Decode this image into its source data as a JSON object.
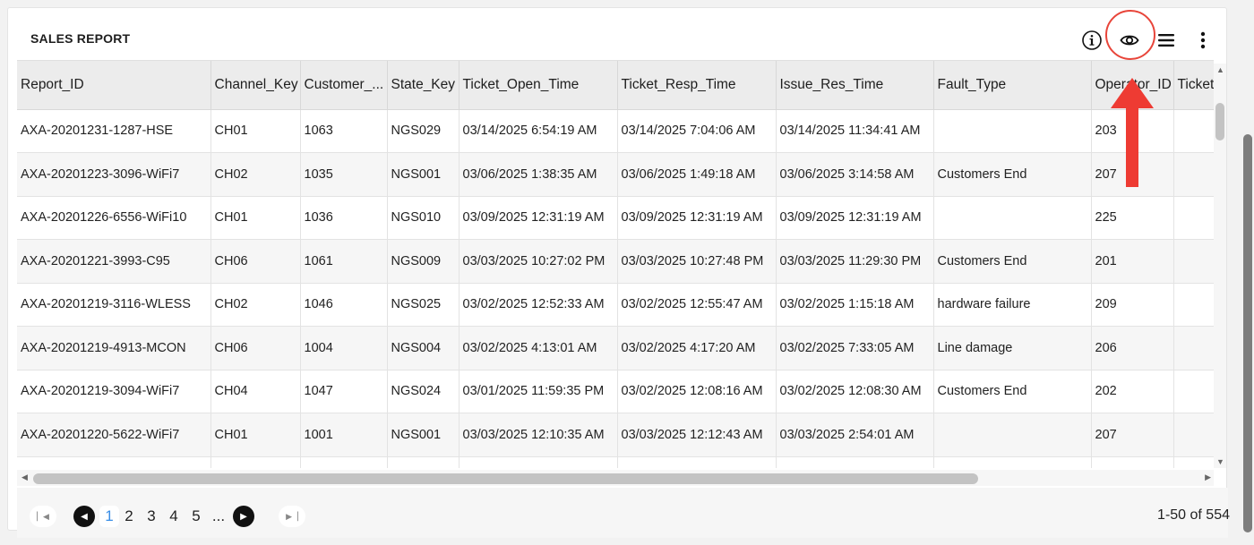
{
  "report": {
    "title": "SALES REPORT"
  },
  "toolbar": {
    "info_icon": "info-icon",
    "visibility_icon": "eye-icon",
    "columns_icon": "hamburger-menu-icon",
    "more_icon": "vertical-dots-icon",
    "highlight_color": "#e8453a"
  },
  "table": {
    "columns": [
      "Report_ID",
      "Channel_Key",
      "Customer_...",
      "State_Key",
      "Ticket_Open_Time",
      "Ticket_Resp_Time",
      "Issue_Res_Time",
      "Fault_Type",
      "Operator_ID",
      "Ticket"
    ],
    "rows": [
      [
        "AXA-20201231-1287-HSE",
        "CH01",
        "1063",
        "NGS029",
        "03/14/2025 6:54:19 AM",
        "03/14/2025 7:04:06 AM",
        "03/14/2025 11:34:41 AM",
        "",
        "203",
        ""
      ],
      [
        "AXA-20201223-3096-WiFi7",
        "CH02",
        "1035",
        "NGS001",
        "03/06/2025 1:38:35 AM",
        "03/06/2025 1:49:18 AM",
        "03/06/2025 3:14:58 AM",
        "Customers End",
        "207",
        ""
      ],
      [
        "AXA-20201226-6556-WiFi10",
        "CH01",
        "1036",
        "NGS010",
        "03/09/2025 12:31:19 AM",
        "03/09/2025 12:31:19 AM",
        "03/09/2025 12:31:19 AM",
        "",
        "225",
        ""
      ],
      [
        "AXA-20201221-3993-C95",
        "CH06",
        "1061",
        "NGS009",
        "03/03/2025 10:27:02 PM",
        "03/03/2025 10:27:48 PM",
        "03/03/2025 11:29:30 PM",
        "Customers End",
        "201",
        ""
      ],
      [
        "AXA-20201219-3116-WLESS",
        "CH02",
        "1046",
        "NGS025",
        "03/02/2025 12:52:33 AM",
        "03/02/2025 12:55:47 AM",
        "03/02/2025 1:15:18 AM",
        "hardware failure",
        "209",
        ""
      ],
      [
        "AXA-20201219-4913-MCON",
        "CH06",
        "1004",
        "NGS004",
        "03/02/2025 4:13:01 AM",
        "03/02/2025 4:17:20 AM",
        "03/02/2025 7:33:05 AM",
        "Line damage",
        "206",
        ""
      ],
      [
        "AXA-20201219-3094-WiFi7",
        "CH04",
        "1047",
        "NGS024",
        "03/01/2025 11:59:35 PM",
        "03/02/2025 12:08:16 AM",
        "03/02/2025 12:08:30 AM",
        "Customers End",
        "202",
        ""
      ],
      [
        "AXA-20201220-5622-WiFi7",
        "CH01",
        "1001",
        "NGS001",
        "03/03/2025 12:10:35 AM",
        "03/03/2025 12:12:43 AM",
        "03/03/2025 2:54:01 AM",
        "",
        "207",
        ""
      ],
      [
        "",
        "",
        "",
        "",
        "",
        "",
        "",
        "",
        "",
        ""
      ]
    ]
  },
  "pagination": {
    "pages": [
      "1",
      "2",
      "3",
      "4",
      "5"
    ],
    "ellipsis": "...",
    "current_page": "1",
    "range_text": "1-50 of 554"
  }
}
